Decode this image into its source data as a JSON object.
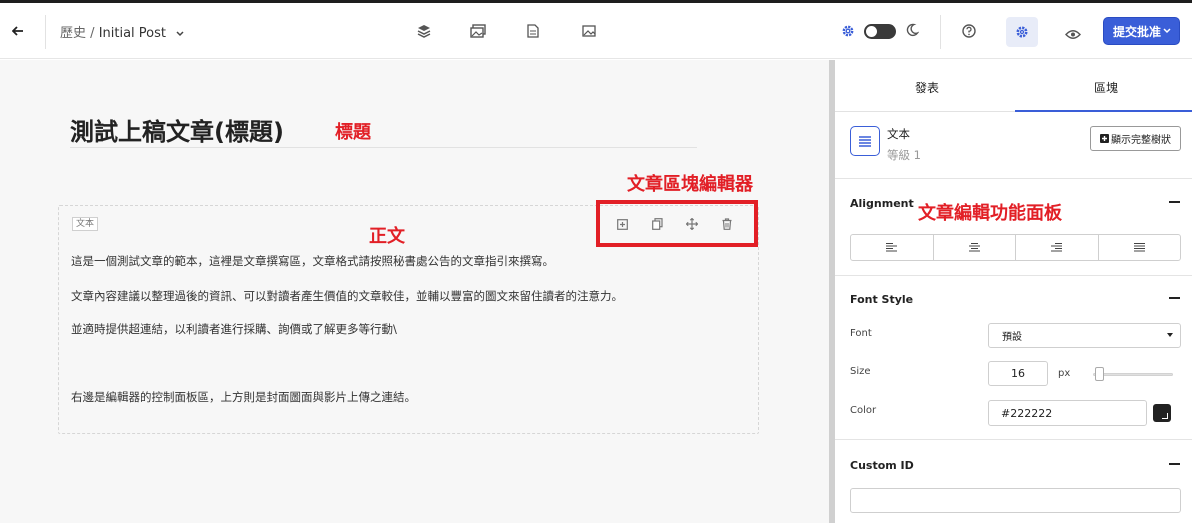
{
  "colors": {
    "accent": "#3a5ed8",
    "annotation": "#e21f26",
    "font_color_value": "#222222"
  },
  "topbar": {
    "back_icon": "arrow-left-icon",
    "breadcrumb_parent": "歷史",
    "breadcrumb_sep": "/",
    "breadcrumb_current": "Initial Post",
    "center_icons": [
      "layers-icon",
      "gallery-icon",
      "document-icon",
      "image-icon"
    ],
    "right_icons": [
      "gear-icon",
      "theme-toggle",
      "moon-icon",
      "help-icon",
      "settings-icon",
      "eye-icon"
    ],
    "submit_label": "提交批准"
  },
  "editor": {
    "title": "測試上稿文章(標題)",
    "block_badge": "文本",
    "paragraphs": [
      "這是一個測試文章的範本，這裡是文章撰寫區，文章格式請按照秘書處公告的文章指引來撰寫。",
      "文章內容建議以整理過後的資訊、可以對讀者產生價值的文章較佳，並輔以豐富的圖文來留住讀者的注意力。",
      "並適時提供超連結，以利讀者進行採購、詢價或了解更多等行動\\",
      "右邊是編輯器的控制面板區，上方則是封面圖面與影片上傳之連結。"
    ],
    "block_tools": [
      "add-block-icon",
      "duplicate-icon",
      "move-icon",
      "trash-icon"
    ]
  },
  "annotations": {
    "title_note": "標題",
    "body_note": "正文",
    "block_editor_note": "文章區塊編輯器",
    "panel_note": "文章編輯功能面板"
  },
  "panel": {
    "tabs": [
      "發表",
      "區塊"
    ],
    "active_tab": "區塊",
    "block_name": "文本",
    "block_level": "等級 1",
    "tree_button": "顯示完整樹狀",
    "alignment": {
      "title": "Alignment",
      "options": [
        "align-left-icon",
        "align-center-icon",
        "align-right-icon",
        "align-justify-icon"
      ]
    },
    "font_style": {
      "title": "Font Style",
      "font_label": "Font",
      "font_value": "預設",
      "size_label": "Size",
      "size_value": "16",
      "size_unit": "px",
      "color_label": "Color",
      "color_value": "#222222"
    },
    "custom_id": {
      "title": "Custom ID",
      "value": ""
    }
  }
}
